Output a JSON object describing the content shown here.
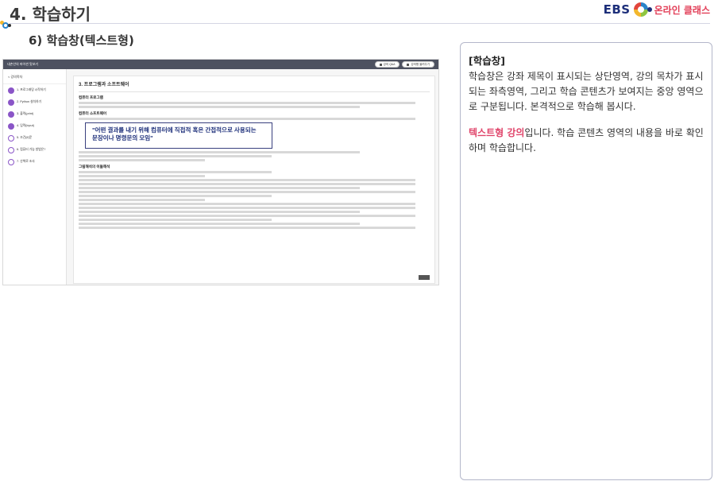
{
  "header": {
    "slide_title": "4. 학습하기",
    "subtitle": "6) 학습창(텍스트형)",
    "logo_ebs": "EBS",
    "logo_text": "온라인 클래스"
  },
  "colors": {
    "brand_navy": "#1d2f7a",
    "accent_red": "#e0456b",
    "purple": "#8a55c7"
  },
  "screenshot": {
    "window_title": "내손안의 파이썬 맛보기",
    "button_qna": "강의 Q&A",
    "button_review": "강의평 올려주기",
    "back_label": "< 강의목차",
    "sidebar_items": [
      "1. 프로그래밍 시작하기",
      "2. Python 설치하기",
      "3. 출력(print)",
      "4. 입력(input)",
      "5. 조건(if)문",
      "6. 컴퓨터 가능 방법은?",
      "7. 산책로 조사"
    ],
    "main_heading": "3. 프로그램과 소프트웨어",
    "section_program": "컴퓨터 프로그램",
    "section_software": "컴퓨터 소프트웨어",
    "quote_part1": "\"어떤 결과를 내기 위해 컴퓨터에 직접적 혹은 간접적으로 사용되는",
    "quote_part2": "문장이나 명령문의 모임\"",
    "section_kind": "그림해석의 이들해석"
  },
  "card": {
    "title": "[학습창]",
    "body": "학습창은 강좌 제목이 표시되는 상단영역, 강의 목차가 표시되는 좌측영역, 그리고 학습 콘텐츠가 보여지는 중앙 영역으로 구분됩니다. 본격적으로 학습해 봅시다.",
    "highlight": "텍스트형 강의",
    "body2": "입니다. 학습 콘텐츠 영역의 내용을 바로 확인하며 학습합니다."
  }
}
